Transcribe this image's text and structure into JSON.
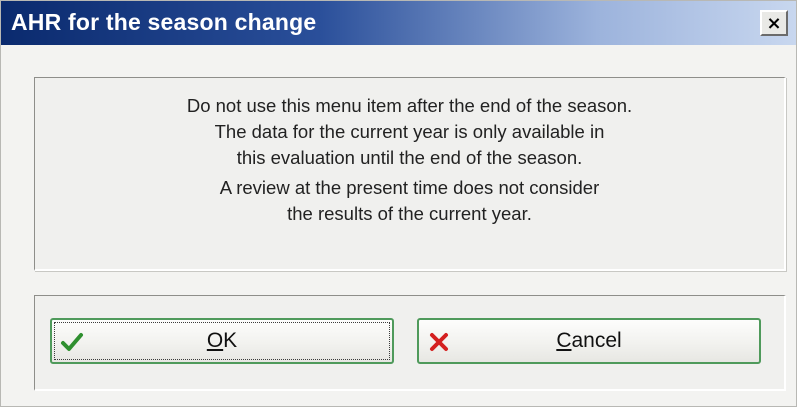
{
  "window": {
    "title": "AHR for the season change",
    "close_label": "×"
  },
  "message": {
    "lines": [
      "Do not use this menu item after the end of the season.",
      "The data for the current year is only available in",
      "this evaluation until the end of the season.",
      "A review at the present time does not consider",
      "the results of the current year."
    ]
  },
  "buttons": {
    "ok": {
      "mnemonic": "O",
      "label_rest": "K",
      "icon": "checkmark-icon",
      "icon_color": "#2f8f2f"
    },
    "cancel": {
      "mnemonic": "C",
      "label_rest": "ancel",
      "icon": "x-mark-icon",
      "icon_color": "#d42020"
    }
  },
  "colors": {
    "titlebar_start": "#0a2a6e",
    "titlebar_end": "#c8d7ef",
    "button_border": "#4f9a5b"
  }
}
